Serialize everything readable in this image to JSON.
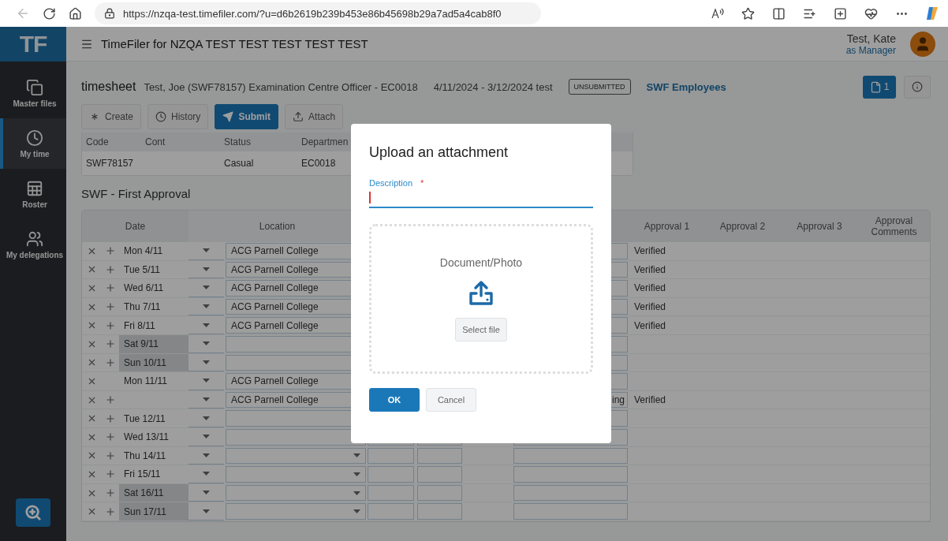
{
  "browser": {
    "url": "https://nzqa-test.timefiler.com/?u=d6b2619b239b453e86b45698b29a7ad5a4cab8f0"
  },
  "app": {
    "logo": "TF",
    "title": "TimeFiler for NZQA TEST TEST TEST TEST TEST",
    "user": {
      "name": "Test, Kate",
      "role": "as Manager"
    }
  },
  "sidebar": {
    "items": [
      {
        "label": "Master files",
        "selected": false
      },
      {
        "label": "My time",
        "selected": true
      },
      {
        "label": "Roster",
        "selected": false
      },
      {
        "label": "My delegations",
        "selected": false
      }
    ]
  },
  "timesheet": {
    "title": "timesheet",
    "employee": "Test, Joe (SWF78157) Examination Centre Officer - EC0018",
    "period": "4/11/2024 - 3/12/2024 test",
    "status": "UNSUBMITTED",
    "group_link": "SWF Employees",
    "attachments_count": "1"
  },
  "toolbar": [
    {
      "label": "Create",
      "primary": false
    },
    {
      "label": "History",
      "primary": false
    },
    {
      "label": "Submit",
      "primary": true
    },
    {
      "label": "Attach",
      "primary": false
    }
  ],
  "employee_table": {
    "columns": [
      "Code",
      "Cont",
      "Status",
      "Departmen"
    ],
    "row": {
      "code": "SWF78157",
      "status": "Casual",
      "department": "EC0018"
    }
  },
  "section_title": "SWF - First Approval",
  "grid": {
    "columns": {
      "date": "Date",
      "location": "Location",
      "approvals": [
        "Approval 1",
        "Approval 2",
        "Approval 3",
        "Approval Comments"
      ]
    },
    "rows": [
      {
        "date": "Mon 4/11",
        "weekend": false,
        "can_add": true,
        "location": "ACG Parnell College",
        "approval_1": "Verified"
      },
      {
        "date": "Tue 5/11",
        "weekend": false,
        "can_add": true,
        "location": "ACG Parnell College",
        "approval_1": "Verified"
      },
      {
        "date": "Wed 6/11",
        "weekend": false,
        "can_add": true,
        "location": "ACG Parnell College",
        "approval_1": "Verified"
      },
      {
        "date": "Thu 7/11",
        "weekend": false,
        "can_add": true,
        "location": "ACG Parnell College",
        "approval_1": "Verified"
      },
      {
        "date": "Fri 8/11",
        "weekend": false,
        "can_add": true,
        "location": "ACG Parnell College",
        "approval_1": "Verified"
      },
      {
        "date": "Sat 9/11",
        "weekend": true,
        "can_add": true
      },
      {
        "date": "Sun 10/11",
        "weekend": true,
        "can_add": true
      },
      {
        "date": "Mon 11/11",
        "weekend": false,
        "can_add": false,
        "location": "ACG Parnell College"
      },
      {
        "weekend": false,
        "can_add": true,
        "location": "ACG Parnell College",
        "column_6": "ing",
        "approval_1": "Verified"
      },
      {
        "date": "Tue 12/11",
        "weekend": false,
        "can_add": true
      },
      {
        "date": "Wed 13/11",
        "weekend": false,
        "can_add": true
      },
      {
        "date": "Thu 14/11",
        "weekend": false,
        "can_add": true
      },
      {
        "date": "Fri 15/11",
        "weekend": false,
        "can_add": true
      },
      {
        "date": "Sat 16/11",
        "weekend": true,
        "can_add": true
      },
      {
        "date": "Sun 17/11",
        "weekend": true,
        "can_add": true
      }
    ]
  },
  "modal": {
    "title": "Upload an attachment",
    "field_label": "Description",
    "required_mark": "*",
    "dropzone_label": "Document/Photo",
    "select_button": "Select file",
    "buttons": [
      {
        "label": "OK",
        "primary": true
      },
      {
        "label": "Cancel",
        "primary": false
      }
    ]
  }
}
